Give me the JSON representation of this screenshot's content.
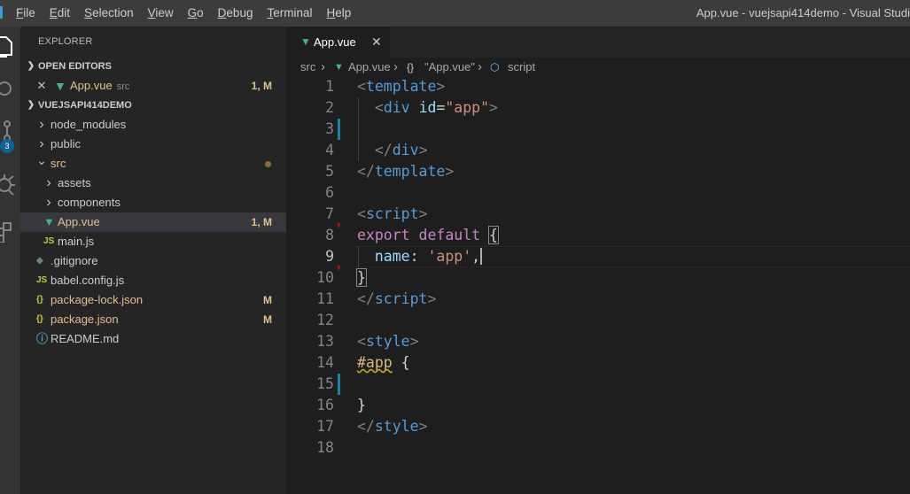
{
  "menubar": {
    "items": [
      {
        "pre": "",
        "u": "F",
        "post": "ile"
      },
      {
        "pre": "",
        "u": "E",
        "post": "dit"
      },
      {
        "pre": "",
        "u": "S",
        "post": "election"
      },
      {
        "pre": "",
        "u": "V",
        "post": "iew"
      },
      {
        "pre": "",
        "u": "G",
        "post": "o"
      },
      {
        "pre": "",
        "u": "D",
        "post": "ebug"
      },
      {
        "pre": "",
        "u": "T",
        "post": "erminal"
      },
      {
        "pre": "",
        "u": "H",
        "post": "elp"
      }
    ],
    "window_title": "App.vue - vuejsapi414demo - Visual Studi"
  },
  "activitybar": {
    "icons": [
      "files-icon",
      "search-icon",
      "source-control-icon",
      "debug-icon",
      "extensions-icon"
    ],
    "scm_badge": "3"
  },
  "sidebar": {
    "title": "EXPLORER",
    "open_editors": {
      "label": "OPEN EDITORS",
      "items": [
        {
          "name": "App.vue",
          "desc": "src",
          "deco": "1, M"
        }
      ]
    },
    "project": {
      "label": "VUEJSAPI414DEMO",
      "tree": [
        {
          "name": "node_modules",
          "kind": "folder",
          "state": "collapsed",
          "depth": 0
        },
        {
          "name": "public",
          "kind": "folder",
          "state": "collapsed",
          "depth": 0
        },
        {
          "name": "src",
          "kind": "folder",
          "state": "expanded",
          "depth": 0
        },
        {
          "name": "assets",
          "kind": "folder",
          "state": "collapsed",
          "depth": 1
        },
        {
          "name": "components",
          "kind": "folder",
          "state": "collapsed",
          "depth": 1
        },
        {
          "name": "App.vue",
          "kind": "vue",
          "depth": 1,
          "deco": "1, M"
        },
        {
          "name": "main.js",
          "kind": "js",
          "icon_text": "JS",
          "depth": 1
        },
        {
          "name": ".gitignore",
          "kind": "git",
          "depth": 0
        },
        {
          "name": "babel.config.js",
          "kind": "js",
          "icon_text": "JS",
          "depth": 0
        },
        {
          "name": "package-lock.json",
          "kind": "json",
          "icon_text": "{}",
          "depth": 0,
          "deco": "M"
        },
        {
          "name": "package.json",
          "kind": "json",
          "icon_text": "{}",
          "depth": 0,
          "deco": "M"
        },
        {
          "name": "README.md",
          "kind": "info",
          "depth": 0
        }
      ]
    }
  },
  "editor": {
    "tab": {
      "label": "App.vue",
      "close": "✕"
    },
    "breadcrumb": [
      "src",
      "App.vue",
      "\"App.vue\"",
      "script"
    ],
    "lines": [
      [
        [
          "punc",
          "<"
        ],
        [
          "tag",
          "template"
        ],
        [
          "punc",
          ">"
        ]
      ],
      [
        [
          "plain",
          "  "
        ],
        [
          "punc",
          "<"
        ],
        [
          "tag",
          "div"
        ],
        [
          "plain",
          " "
        ],
        [
          "attr",
          "id"
        ],
        [
          "plain",
          "="
        ],
        [
          "str",
          "\"app\""
        ],
        [
          "punc",
          ">"
        ]
      ],
      [],
      [
        [
          "plain",
          "  "
        ],
        [
          "punc",
          "</"
        ],
        [
          "tag",
          "div"
        ],
        [
          "punc",
          ">"
        ]
      ],
      [
        [
          "punc",
          "</"
        ],
        [
          "tag",
          "template"
        ],
        [
          "punc",
          ">"
        ]
      ],
      [],
      [
        [
          "punc",
          "<"
        ],
        [
          "tag",
          "script"
        ],
        [
          "punc",
          ">"
        ]
      ],
      [
        [
          "kw",
          "export"
        ],
        [
          "plain",
          " "
        ],
        [
          "kw",
          "default"
        ],
        [
          "plain",
          " "
        ],
        [
          "brace",
          "{"
        ]
      ],
      [
        [
          "plain",
          "  "
        ],
        [
          "attr",
          "name"
        ],
        [
          "plain",
          ": "
        ],
        [
          "str",
          "'app'"
        ],
        [
          "plain",
          ","
        ]
      ],
      [
        [
          "brace",
          "}"
        ]
      ],
      [
        [
          "punc",
          "</"
        ],
        [
          "tag",
          "script"
        ],
        [
          "punc",
          ">"
        ]
      ],
      [],
      [
        [
          "punc",
          "<"
        ],
        [
          "tag",
          "style"
        ],
        [
          "punc",
          ">"
        ]
      ],
      [
        [
          "selsq",
          "#app"
        ],
        [
          "plain",
          " {"
        ]
      ],
      [],
      [
        [
          "plain",
          "}"
        ]
      ],
      [
        [
          "punc",
          "</"
        ],
        [
          "tag",
          "style"
        ],
        [
          "punc",
          ">"
        ]
      ],
      []
    ],
    "line_numbers": [
      "1",
      "2",
      "3",
      "4",
      "5",
      "6",
      "7",
      "8",
      "9",
      "10",
      "11",
      "12",
      "13",
      "14",
      "15",
      "16",
      "17",
      "18"
    ]
  }
}
